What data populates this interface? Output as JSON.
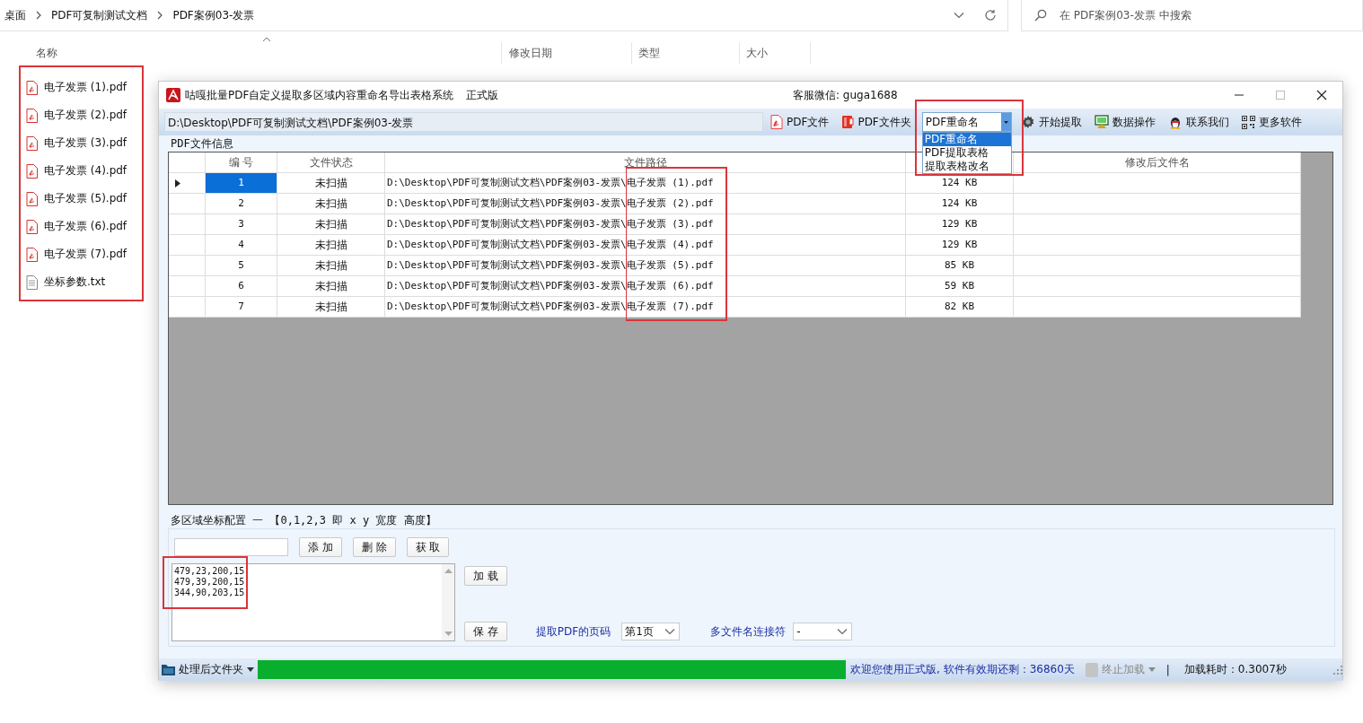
{
  "explorer": {
    "breadcrumbs": [
      "桌面",
      "PDF可复制测试文档",
      "PDF案例03-发票"
    ],
    "search": {
      "placeholder": "在 PDF案例03-发票 中搜索"
    },
    "columns": [
      "名称",
      "修改日期",
      "类型",
      "大小"
    ],
    "files": [
      {
        "name": "电子发票 (1).pdf",
        "kind": "pdf"
      },
      {
        "name": "电子发票 (2).pdf",
        "kind": "pdf"
      },
      {
        "name": "电子发票 (3).pdf",
        "kind": "pdf"
      },
      {
        "name": "电子发票 (4).pdf",
        "kind": "pdf"
      },
      {
        "name": "电子发票 (5).pdf",
        "kind": "pdf"
      },
      {
        "name": "电子发票 (6).pdf",
        "kind": "pdf"
      },
      {
        "name": "电子发票 (7).pdf",
        "kind": "pdf"
      },
      {
        "name": "坐标参数.txt",
        "kind": "txt"
      }
    ]
  },
  "app": {
    "title": "咕嘎批量PDF自定义提取多区域内容重命名导出表格系统",
    "edition": "正式版",
    "support": "客服微信: guga1688",
    "path": "D:\\Desktop\\PDF可复制测试文档\\PDF案例03-发票",
    "toolbar_left": [
      {
        "label": "PDF文件",
        "kind": "pdf"
      },
      {
        "label": "PDF文件夹",
        "kind": "folder"
      }
    ],
    "mode_select": {
      "value": "PDF重命名",
      "expanded": true,
      "options": [
        {
          "label": "PDF重命名",
          "selected": true
        },
        {
          "label": "PDF提取表格",
          "selected": false
        },
        {
          "label": "提取表格改名",
          "selected": false
        }
      ]
    },
    "toolbar_right": [
      {
        "label": "开始提取",
        "kind": "gear"
      },
      {
        "label": "数据操作",
        "kind": "monitor"
      },
      {
        "label": "联系我们",
        "kind": "penguin"
      },
      {
        "label": "更多软件",
        "kind": "qr"
      }
    ],
    "file_group": "PDF文件信息",
    "table": {
      "headers": {
        "number": "编 号",
        "status": "文件状态",
        "path": "文件路径",
        "new_name": "修改后文件名"
      },
      "rows": [
        {
          "selected": true,
          "number": "1",
          "status": "未扫描",
          "path": "D:\\Desktop\\PDF可复制测试文档\\PDF案例03-发票\\电子发票 (1).pdf",
          "size": "124 KB"
        },
        {
          "selected": false,
          "number": "2",
          "status": "未扫描",
          "path": "D:\\Desktop\\PDF可复制测试文档\\PDF案例03-发票\\电子发票 (2).pdf",
          "size": "124 KB"
        },
        {
          "selected": false,
          "number": "3",
          "status": "未扫描",
          "path": "D:\\Desktop\\PDF可复制测试文档\\PDF案例03-发票\\电子发票 (3).pdf",
          "size": "129 KB"
        },
        {
          "selected": false,
          "number": "4",
          "status": "未扫描",
          "path": "D:\\Desktop\\PDF可复制测试文档\\PDF案例03-发票\\电子发票 (4).pdf",
          "size": "129 KB"
        },
        {
          "selected": false,
          "number": "5",
          "status": "未扫描",
          "path": "D:\\Desktop\\PDF可复制测试文档\\PDF案例03-发票\\电子发票 (5).pdf",
          "size": "85 KB"
        },
        {
          "selected": false,
          "number": "6",
          "status": "未扫描",
          "path": "D:\\Desktop\\PDF可复制测试文档\\PDF案例03-发票\\电子发票 (6).pdf",
          "size": "59 KB"
        },
        {
          "selected": false,
          "number": "7",
          "status": "未扫描",
          "path": "D:\\Desktop\\PDF可复制测试文档\\PDF案例03-发票\\电子发票 (7).pdf",
          "size": "82 KB"
        }
      ]
    },
    "coords": {
      "title": "多区域坐标配置 一 【0,1,2,3 即 x y 宽度 高度】",
      "buttons": [
        "添 加",
        "删 除",
        "获 取"
      ],
      "lines": [
        "479,23,200,15",
        "479,39,200,15",
        "344,90,203,15"
      ],
      "load_button": "加 载",
      "save_button": "保 存",
      "page_label": "提取PDF的页码",
      "page_value": "第1页",
      "joiner_label": "多文件名连接符",
      "joiner_value": "-"
    },
    "status": {
      "folder_button": "处理后文件夹",
      "progress": {
        "level": 1
      },
      "message": "欢迎您使用正式版, 软件有效期还剩：36860天",
      "stop": {
        "label": "终止加载",
        "disabled": true
      },
      "separator": "|",
      "elapsed": "加载耗时：0.3007秒"
    }
  }
}
